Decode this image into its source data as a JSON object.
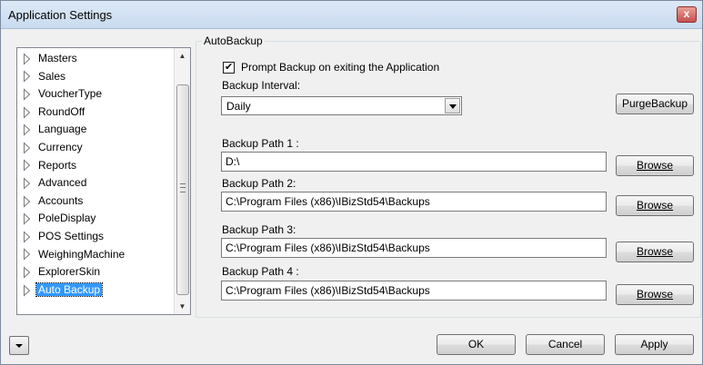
{
  "window": {
    "title": "Application Settings",
    "close_glyph": "x"
  },
  "tree": {
    "items": [
      {
        "label": "Masters"
      },
      {
        "label": "Sales"
      },
      {
        "label": "VoucherType"
      },
      {
        "label": "RoundOff"
      },
      {
        "label": "Language"
      },
      {
        "label": "Currency"
      },
      {
        "label": "Reports"
      },
      {
        "label": "Advanced"
      },
      {
        "label": "Accounts"
      },
      {
        "label": "PoleDisplay"
      },
      {
        "label": "POS Settings"
      },
      {
        "label": "WeighingMachine"
      },
      {
        "label": "ExplorerSkin"
      },
      {
        "label": "Auto Backup",
        "selected": true
      }
    ],
    "arrow_icon": "triangle-right-outline-icon"
  },
  "autobackup": {
    "group_title": "AutoBackup",
    "prompt_label": "Prompt Backup on exiting the Application",
    "prompt_checked": true,
    "interval_label": "Backup Interval:",
    "interval_value": "Daily",
    "purge_button": "PurgeBackup",
    "paths": [
      {
        "label": "Backup Path 1 :",
        "value": "D:\\",
        "button": "Browse"
      },
      {
        "label": "Backup Path 2:",
        "value": "C:\\Program Files (x86)\\IBizStd54\\Backups",
        "button": "Browse"
      },
      {
        "label": "Backup Path 3:",
        "value": "C:\\Program Files (x86)\\IBizStd54\\Backups",
        "button": "Browse"
      },
      {
        "label": "Backup Path 4 :",
        "value": "C:\\Program Files (x86)\\IBizStd54\\Backups",
        "button": "Browse"
      }
    ]
  },
  "footer": {
    "ok": "OK",
    "cancel": "Cancel",
    "apply": "Apply"
  },
  "colors": {
    "selection": "#3399ff",
    "titlebar": "#c9dbf0",
    "close": "#c75050"
  }
}
